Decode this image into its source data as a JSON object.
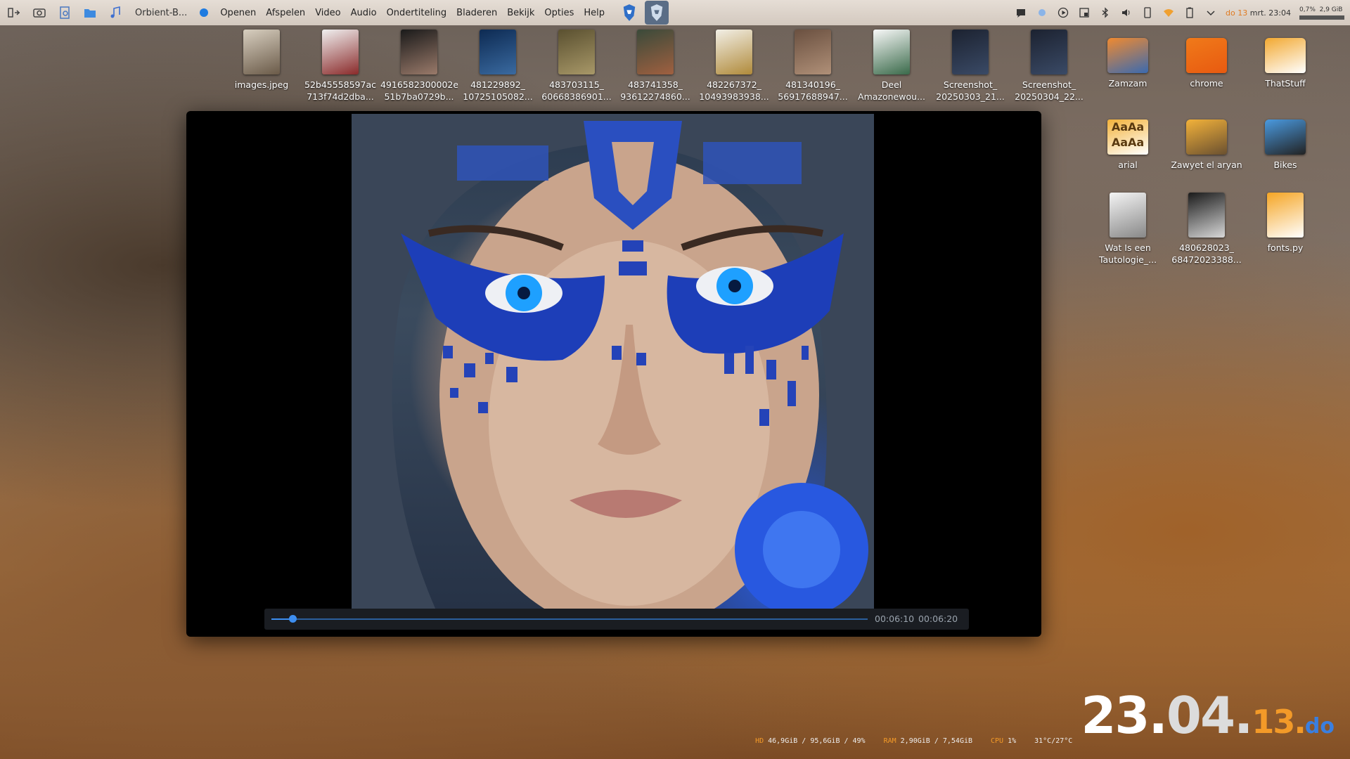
{
  "topbar": {
    "app_title": "Orbient-B...",
    "menu": [
      "Openen",
      "Afspelen",
      "Video",
      "Audio",
      "Ondertiteling",
      "Bladeren",
      "Bekijk",
      "Opties",
      "Help"
    ],
    "tray_date_prefix": "do",
    "tray_day": "13",
    "tray_month": "mrt.",
    "tray_time": "23:04",
    "tray_cpu": "0,7%",
    "tray_mem": "2,9 GiB"
  },
  "desktop": {
    "icons": [
      {
        "l1": "images.jpeg",
        "l2": ""
      },
      {
        "l1": "52b45558597ac",
        "l2": "713f74d2dba..."
      },
      {
        "l1": "4916582300002e",
        "l2": "51b7ba0729b..."
      },
      {
        "l1": "481229892_",
        "l2": "10725105082..."
      },
      {
        "l1": "483703115_",
        "l2": "60668386901..."
      },
      {
        "l1": "483741358_",
        "l2": "93612274860..."
      },
      {
        "l1": "482267372_",
        "l2": "10493983938..."
      },
      {
        "l1": "481340196_",
        "l2": "56917688947..."
      },
      {
        "l1": "Deel",
        "l2": "Amazonewou..."
      },
      {
        "l1": "Screenshot_",
        "l2": "20250303_21..."
      },
      {
        "l1": "Screenshot_",
        "l2": "20250304_22..."
      },
      {
        "l1": "Zamzam",
        "l2": ""
      },
      {
        "l1": "chrome",
        "l2": ""
      },
      {
        "l1": "ThatStuff",
        "l2": ""
      },
      {
        "l1": "arial",
        "l2": ""
      },
      {
        "l1": "Zawyet el aryan",
        "l2": ""
      },
      {
        "l1": "Bikes",
        "l2": ""
      },
      {
        "l1": "Wat Is een",
        "l2": "Tautologie_..."
      },
      {
        "l1": "480628023_",
        "l2": "68472023388..."
      },
      {
        "l1": "fonts.py",
        "l2": ""
      }
    ],
    "font_preview": "AaAa"
  },
  "player": {
    "elapsed": "00:06:10",
    "total": "00:06:20",
    "progress": 0.035
  },
  "conky": {
    "hd_label": "HD",
    "hd_value": "46,9GiB / 95,6GiB / 49%",
    "ram_label": "RAM",
    "ram_value": "2,90GiB / 7,54GiB",
    "cpu_label": "CPU",
    "cpu_value": "1%",
    "temp_value": "31°C/27°C",
    "clock_day": "23.",
    "clock_min": "04.",
    "clock_hour": "13.",
    "clock_weekday": "do"
  }
}
